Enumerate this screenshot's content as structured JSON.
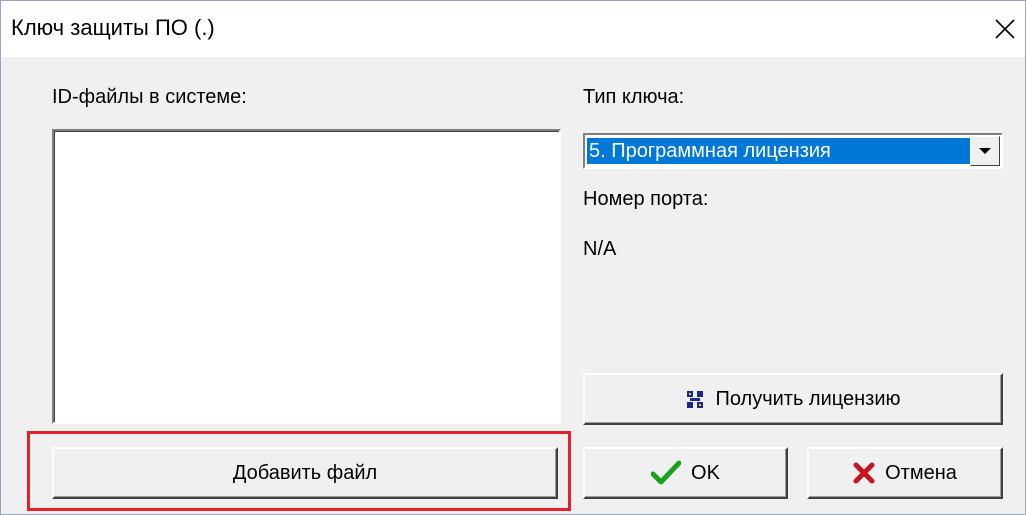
{
  "window": {
    "title": "Ключ защиты ПО (.)",
    "close_symbol": "✕"
  },
  "left": {
    "id_files_label": "ID-файлы в системе:",
    "id_files": [],
    "add_file_button": "Добавить файл"
  },
  "right": {
    "key_type_label": "Тип ключа:",
    "key_type_selected": "5. Программная лицензия",
    "port_label": "Номер порта:",
    "port_value": "N/A",
    "get_license_button": "Получить лицензию"
  },
  "footer": {
    "ok_button": "OK",
    "cancel_button": "Отмена"
  },
  "colors": {
    "selection": "#0078d7",
    "highlight_frame": "#e3212a",
    "ok_check": "#1aa01a",
    "cancel_x": "#c8141e",
    "license_icon": "#1a2a8a"
  },
  "icons": {
    "close": "close-icon",
    "dropdown": "dropdown-arrow-icon",
    "license": "license-key-icon",
    "ok": "checkmark-icon",
    "cancel": "cross-icon"
  }
}
